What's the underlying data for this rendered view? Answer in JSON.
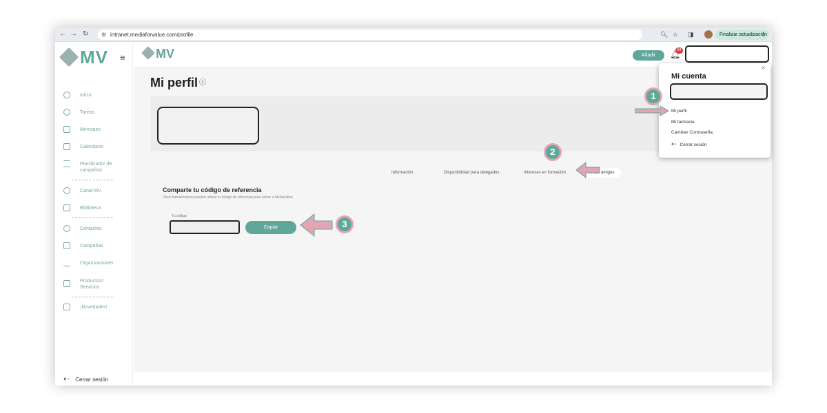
{
  "browser": {
    "url": "intranet.mediaforvalue.com/profile",
    "update_label": "Finalizar actualización"
  },
  "sidebar": {
    "logo": "MV",
    "items": [
      {
        "label": "Inicio",
        "icon": "home-icon"
      },
      {
        "label": "Tareas",
        "icon": "check-circle-icon"
      },
      {
        "label": "Mensajes",
        "icon": "mail-icon"
      },
      {
        "label": "Calendario",
        "icon": "calendar-icon"
      },
      {
        "label": "Planificador de campañas",
        "icon": "planner-icon"
      },
      {
        "label": "Canal MV",
        "icon": "play-icon"
      },
      {
        "label": "Biblioteca",
        "icon": "grid-icon"
      },
      {
        "label": "Contactos",
        "icon": "contacts-icon"
      },
      {
        "label": "Campañas",
        "icon": "megaphone-icon"
      },
      {
        "label": "Organizaciones",
        "icon": "microscope-icon"
      },
      {
        "label": "Productos/ Servicios",
        "icon": "store-icon"
      },
      {
        "label": "¡Novedades!",
        "icon": "news-icon"
      }
    ],
    "logout": "Cerrar sesión"
  },
  "header": {
    "logo": "MV",
    "add_button": "Añadir",
    "notifications": "84"
  },
  "page": {
    "title": "Mi perfil",
    "tabs": [
      "Información",
      "Disponibilidad para delegados",
      "Intereses en formación",
      "Invitar amigos"
    ],
    "active_tab": "Invitar amigos",
    "section_title": "Comparte tu código de referencia",
    "section_sub": "Otros farmacéuticos pueden utilizar tu código de referencia para unirse a MediaValue",
    "code_label": "Tu código",
    "copy_button": "Copiar"
  },
  "dropdown": {
    "title": "Mi cuenta",
    "items": [
      "Mi perfil",
      "Mi farmacia",
      "Cambiar Contraseña",
      "Cerrar sesión"
    ]
  },
  "annotations": [
    "1",
    "2",
    "3"
  ],
  "colors": {
    "accent": "#5fa899",
    "arrow": "#e3a4b4",
    "badge": "#d9363e"
  }
}
